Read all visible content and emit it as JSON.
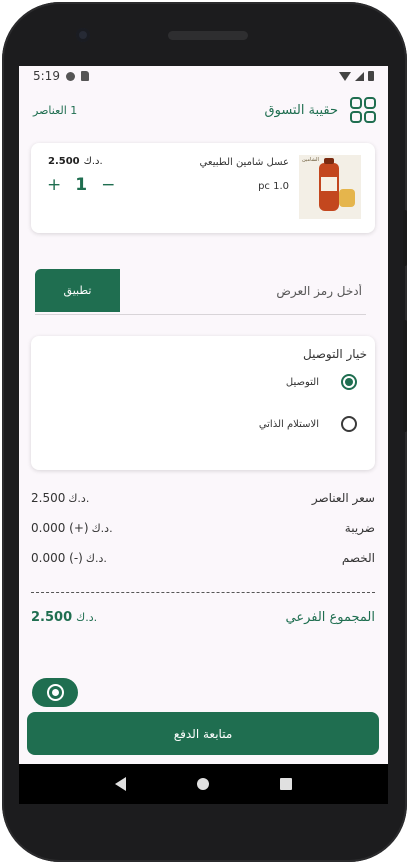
{
  "status_bar": {
    "time": "5:19"
  },
  "app_bar": {
    "title": "حقيبة التسوق",
    "item_count": "1 العناصر",
    "menu_icon": "grid-icon"
  },
  "cart": {
    "items": [
      {
        "name": "عسل شامين الطبيعي",
        "unit": "pc 1.0",
        "price": "2.500",
        "currency": "د.ك.",
        "quantity": "1",
        "increase_label": "+",
        "decrease_label": "−",
        "image_brand": "الشامين"
      }
    ]
  },
  "promo": {
    "placeholder": "أدخل رمز العرض",
    "value": "",
    "apply_label": "تطبيق"
  },
  "delivery": {
    "title": "خيار التوصيل",
    "options": [
      {
        "label": "التوصيل",
        "selected": true
      },
      {
        "label": "الاستلام الذاتي",
        "selected": false
      }
    ]
  },
  "summary": {
    "items_price": {
      "label": "سعر العناصر",
      "currency": "د.ك.",
      "amount": "2.500"
    },
    "tax": {
      "label": "ضريبة",
      "currency": "د.ك.",
      "amount": "0.000 (+)"
    },
    "discount": {
      "label": "الخصم",
      "currency": "د.ك.",
      "amount": "0.000 (-)"
    },
    "subtotal": {
      "label": "المجموع الفرعي",
      "currency": "د.ك.",
      "amount": "2.500"
    }
  },
  "whatsapp": {
    "icon": "whatsapp-icon"
  },
  "checkout": {
    "label": "متابعة الدفع"
  },
  "colors": {
    "accent": "#1f6e50",
    "background": "#fbf7fb",
    "card": "#ffffff"
  }
}
